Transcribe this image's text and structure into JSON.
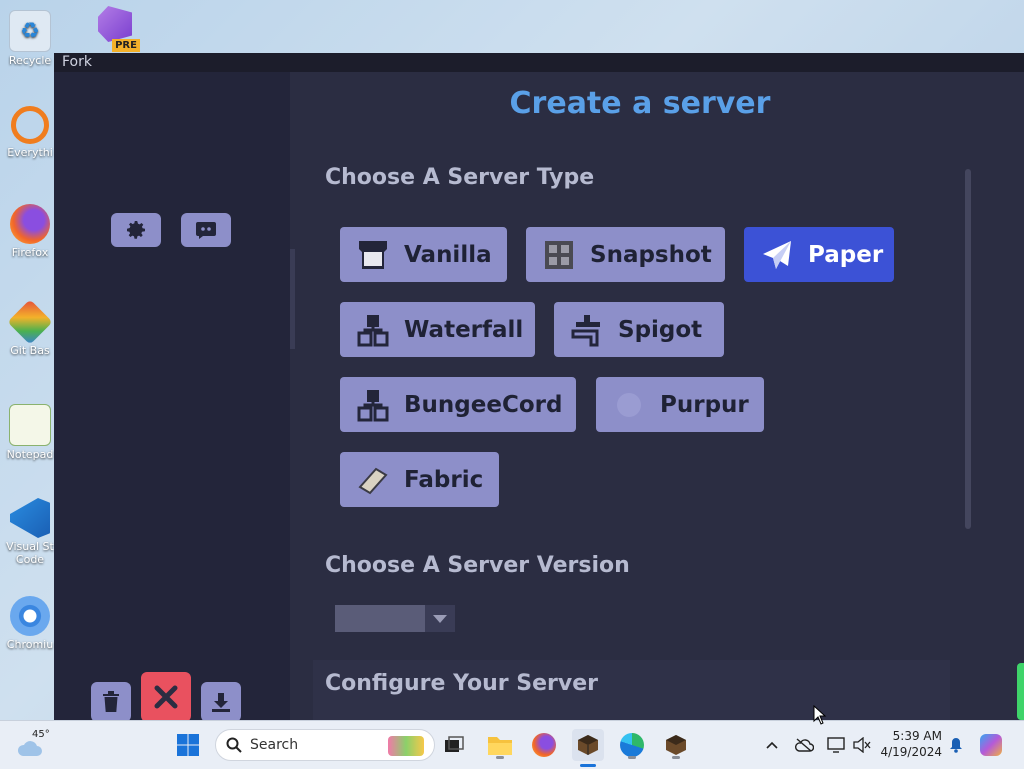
{
  "desktop": {
    "icons": [
      {
        "label": "Recycle",
        "name": "recycle-bin-icon"
      },
      {
        "label": "Everythi",
        "name": "everything-icon"
      },
      {
        "label": "Firefox",
        "name": "firefox-icon"
      },
      {
        "label": "Git Bas",
        "name": "git-bash-icon"
      },
      {
        "label": "Notepad",
        "name": "notepad-icon"
      },
      {
        "label": "Visual St Code",
        "name": "vscode-icon"
      },
      {
        "label": "Chromiu",
        "name": "chromium-icon"
      }
    ],
    "vs_badge": "PRE"
  },
  "window": {
    "title": "Fork",
    "main": {
      "heading": "Create a server",
      "server_type_heading": "Choose A Server Type",
      "server_types": [
        {
          "label": "Vanilla",
          "selected": false,
          "icon": "vanilla-icon"
        },
        {
          "label": "Snapshot",
          "selected": false,
          "icon": "snapshot-icon"
        },
        {
          "label": "Paper",
          "selected": true,
          "icon": "paper-plane-icon"
        },
        {
          "label": "Waterfall",
          "selected": false,
          "icon": "waterfall-icon"
        },
        {
          "label": "Spigot",
          "selected": false,
          "icon": "spigot-icon"
        },
        {
          "label": "BungeeCord",
          "selected": false,
          "icon": "bungeecord-icon"
        },
        {
          "label": "Purpur",
          "selected": false,
          "icon": "purpur-icon"
        },
        {
          "label": "Fabric",
          "selected": false,
          "icon": "fabric-icon"
        }
      ],
      "server_version_heading": "Choose A Server Version",
      "version_value": "",
      "configure_heading": "Configure Your Server"
    },
    "colors": {
      "accent": "#3c52d6",
      "heading": "#5aa0e8",
      "button": "#8d8fc9",
      "danger": "#e9515f"
    }
  },
  "taskbar": {
    "weather": "45°",
    "search_placeholder": "Search",
    "time": "5:39 AM",
    "date": "4/19/2024"
  }
}
